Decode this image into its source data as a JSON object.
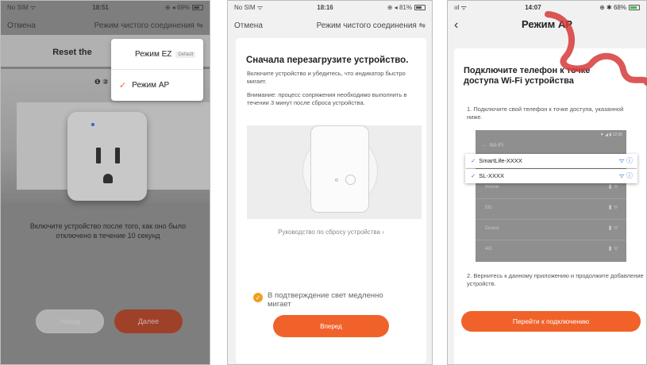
{
  "panel1": {
    "status": {
      "carrier": "No SIM ᯤ",
      "time": "18:51",
      "battery": "⊕ ◂ 69%"
    },
    "nav": {
      "cancel": "Отмена",
      "mode": "Режим чистого соединения ⇋"
    },
    "reset_title": "Reset the",
    "step_dots": "❶ ②",
    "instruction": "Включите устройство после того, как оно было отключено в течение 10 секунд",
    "back_button": "Назад",
    "next_button": "Далее",
    "dropdown": {
      "option_ez": "Режим EZ",
      "default_tag": "Default",
      "option_ap": "Режим AP",
      "check": "✓"
    }
  },
  "panel2": {
    "status": {
      "carrier": "No SIM ᯤ",
      "time": "18:16",
      "battery": "⊕ ◂ 81%"
    },
    "nav": {
      "cancel": "Отмена",
      "mode": "Режим чистого соединения ⇋"
    },
    "title": "Сначала перезагрузите устройство.",
    "subtitle": "Включите устройство и убедитесь, что индикатор быстро мигает.",
    "note": "Внимание: процесс сопряжения необходимо выполнить в течении 3 минут после сброса устройства.",
    "guide_link": "Руководство по сбросу устройства ›",
    "confirm_text": "В подтверждение свет медленно мигает",
    "forward_button": "Вперед"
  },
  "panel3": {
    "status": {
      "signal": "ııl ᯤ",
      "time": "14:07",
      "battery": "⊕ ✱ 68%"
    },
    "back": "‹",
    "nav_title": "Режим AP",
    "title": "Подключите телефон к точке доступа Wi-Fi устройства",
    "step1": "1. Подключите свой телефон к точке доступа, указанной ниже.",
    "wifi_statusbar": "▼ ◢ ▮ 12:30",
    "wifi_label": "← Wi-Fi",
    "highlighted_networks": [
      "SmartLife-XXXX",
      "SL-XXXX"
    ],
    "networks": [
      "Home",
      "5G",
      "Guest",
      "4G"
    ],
    "step2": "2. Вернитесь к данному приложению и продолжите добавление устройств.",
    "go_button": "Перейти к подключению"
  },
  "icons": {
    "check": "✓",
    "wifi_info": "ᯤ ⓘ",
    "lock_wifi": "▮ ᯤ"
  },
  "colors": {
    "accent": "#f0622a",
    "link_blue": "#3a7ed8",
    "confirm_yellow": "#f0a020",
    "watermark_red": "#d63a3a"
  }
}
